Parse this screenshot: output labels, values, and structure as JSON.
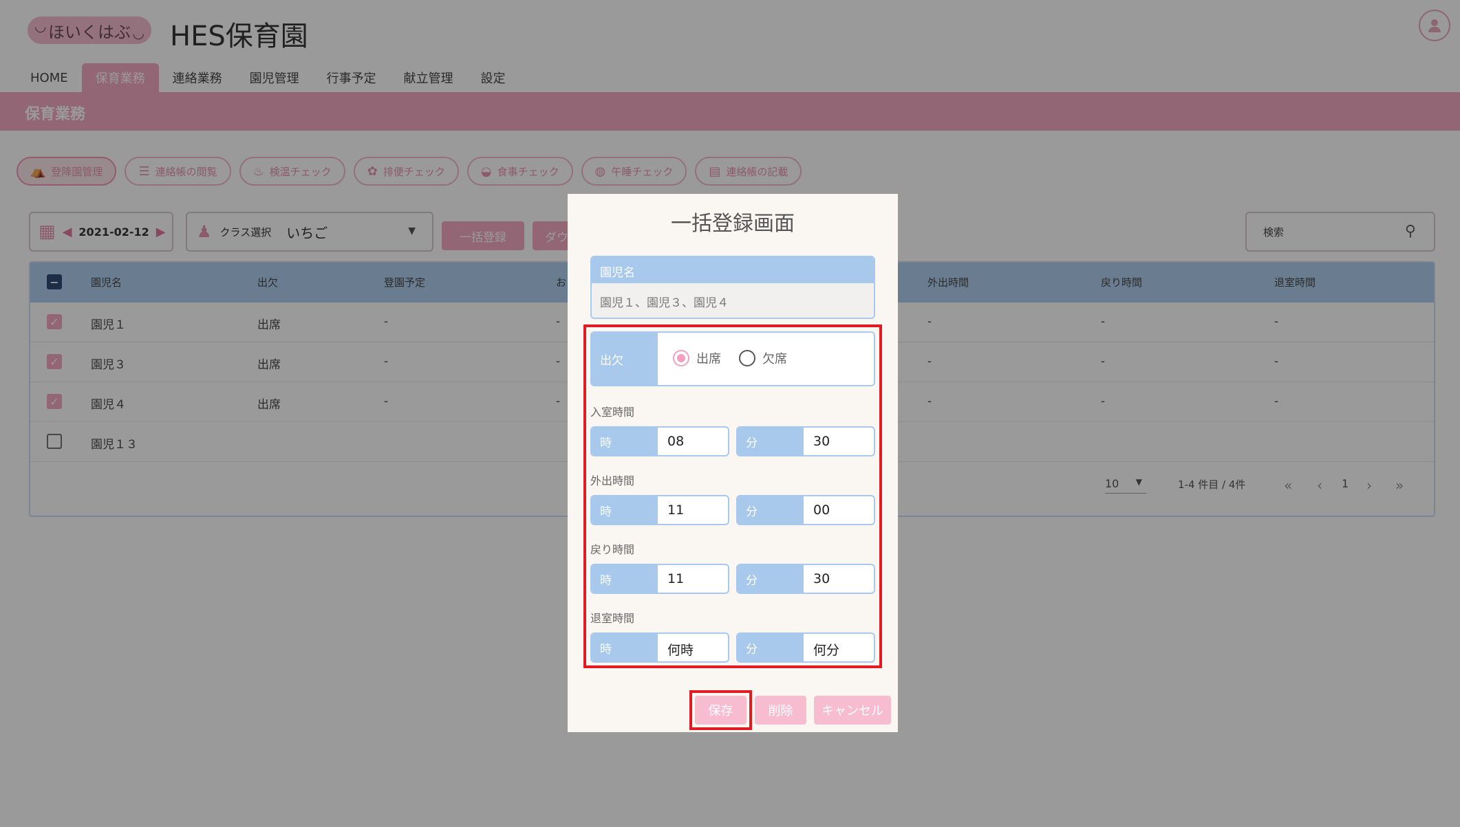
{
  "header": {
    "logo_text": "ほいくはぶ",
    "app_title": "HES保育園",
    "user_icon": "user-icon"
  },
  "nav": {
    "items": [
      {
        "label": "HOME"
      },
      {
        "label": "保育業務"
      },
      {
        "label": "連絡業務"
      },
      {
        "label": "園児管理"
      },
      {
        "label": "行事予定"
      },
      {
        "label": "献立管理"
      },
      {
        "label": "設定"
      }
    ],
    "active_index": 1
  },
  "subbar": {
    "title": "保育業務"
  },
  "chips": [
    {
      "label": "登降園管理",
      "icon": "tent-icon"
    },
    {
      "label": "連絡帳の閲覧",
      "icon": "list-icon"
    },
    {
      "label": "検温チェック",
      "icon": "thermometer-icon"
    },
    {
      "label": "排便チェック",
      "icon": "duck-icon"
    },
    {
      "label": "食事チェック",
      "icon": "bowl-icon"
    },
    {
      "label": "午睡チェック",
      "icon": "globe-icon"
    },
    {
      "label": "連絡帳の記載",
      "icon": "notebook-icon"
    }
  ],
  "toolbar": {
    "date": "2021-02-12",
    "class_label": "クラス選択",
    "class_value": "いちご",
    "bulk_register": "一括登録",
    "download": "ダウ",
    "search_placeholder": "検索"
  },
  "table": {
    "headers": [
      "園児名",
      "出欠",
      "登園予定",
      "お",
      "外出時間",
      "戻り時間",
      "退室時間"
    ],
    "rows": [
      {
        "checked": true,
        "name": "園児１",
        "attendance": "出席",
        "col3": "-",
        "col4": "-",
        "col5": "-",
        "col6": "-",
        "col7": "-"
      },
      {
        "checked": true,
        "name": "園児３",
        "attendance": "出席",
        "col3": "-",
        "col4": "-",
        "col5": "-",
        "col6": "-",
        "col7": "-"
      },
      {
        "checked": true,
        "name": "園児４",
        "attendance": "出席",
        "col3": "-",
        "col4": "-",
        "col5": "-",
        "col6": "-",
        "col7": "-"
      },
      {
        "checked": false,
        "name": "園児１３",
        "attendance": "",
        "col3": "",
        "col4": "",
        "col5": "",
        "col6": "",
        "col7": ""
      }
    ],
    "per_page": "10",
    "range_text": "1-4 件目 / 4件",
    "current_page": "1"
  },
  "modal": {
    "title": "一括登録画面",
    "names_label": "園児名",
    "names_value": "園児１、園児３、園児４",
    "attendance_label": "出欠",
    "attendance_options": [
      "出席",
      "欠席"
    ],
    "attendance_selected": 0,
    "sections": [
      {
        "label": "入室時間",
        "hour_label": "時",
        "hour": "08",
        "min_label": "分",
        "min": "30"
      },
      {
        "label": "外出時間",
        "hour_label": "時",
        "hour": "11",
        "min_label": "分",
        "min": "00"
      },
      {
        "label": "戻り時間",
        "hour_label": "時",
        "hour": "11",
        "min_label": "分",
        "min": "30"
      },
      {
        "label": "退室時間",
        "hour_label": "時",
        "hour": "何時",
        "min_label": "分",
        "min": "何分"
      }
    ],
    "buttons": {
      "save": "保存",
      "delete": "削除",
      "cancel": "キャンセル"
    }
  },
  "colors": {
    "accent_pink": "#f3a0bd",
    "accent_blue": "#a8c8ec",
    "highlight_red": "#e11b22"
  }
}
